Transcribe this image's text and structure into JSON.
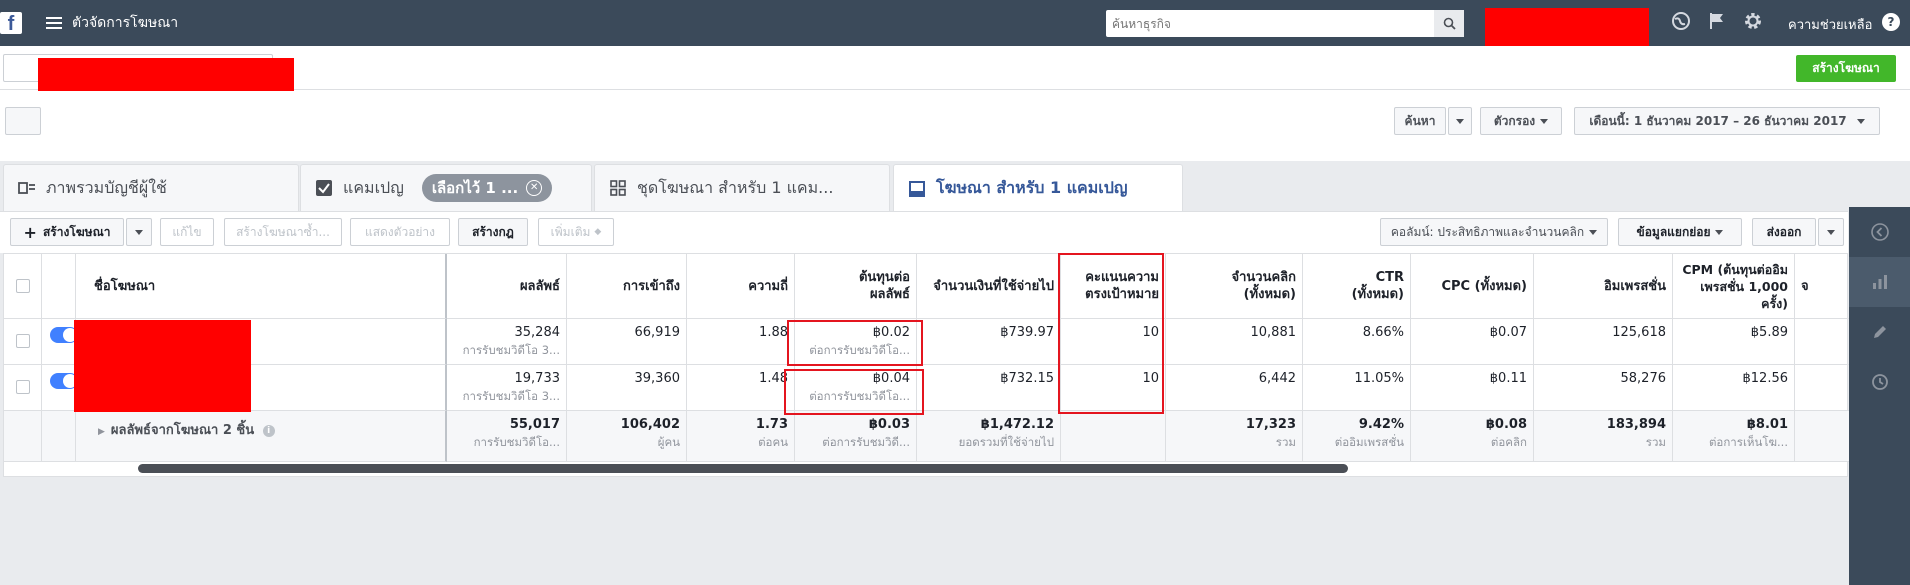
{
  "app": {
    "logo": "f",
    "title": "ตัวจัดการโฆษณา"
  },
  "search": {
    "placeholder": "ค้นหาธุรกิจ"
  },
  "header": {
    "help_label": "ความช่วยเหลือ",
    "help_q": "?"
  },
  "icons": {
    "globe": "globe-icon",
    "flag": "flag-icon",
    "gear": "gear-icon"
  },
  "create_ad_button": "สร้างโฆษณา",
  "controls": {
    "search_label": "ค้นหา",
    "filters_label": "ตัวกรอง",
    "date_range": "เดือนนี้: 1 ธันวาคม 2017 – 26 ธันวาคม 2017"
  },
  "tabs": [
    {
      "label": "ภาพรวมบัญชีผู้ใช้"
    },
    {
      "label": "แคมเปญ",
      "pill": "เลือกไว้ 1 ..."
    },
    {
      "label": "ชุดโฆษณา สำหรับ 1 แคม..."
    },
    {
      "label": "โฆษณา สำหรับ 1 แคมเปญ"
    }
  ],
  "toolbar": {
    "create": "สร้างโฆษณา",
    "edit": "แก้ไข",
    "duplicate": "สร้างโฆษณาซ้ำ...",
    "preview": "แสดงตัวอย่าง",
    "create_rule": "สร้างกฎ",
    "more": "เพิ่มเติม",
    "columns": "คอลัมน์: ประสิทธิภาพและจำนวนคลิก",
    "breakdown": "ข้อมูลแยกย่อย",
    "export": "ส่งออก"
  },
  "table": {
    "headers": {
      "name": "ชื่อโฆษณา",
      "results": "ผลลัพธ์",
      "reach": "การเข้าถึง",
      "frequency": "ความถี่",
      "cpr": "ต้นทุนต่อผลลัพธ์",
      "spent": "จำนวนเงินที่ใช้จ่ายไป",
      "relevance": "คะแนนความตรงเป้าหมาย",
      "clicks": "จำนวนคลิก (ทั้งหมด)",
      "ctr": "CTR (ทั้งหมด)",
      "cpc": "CPC (ทั้งหมด)",
      "impressions": "อิมเพรสชั่น",
      "cpm": "CPM (ต้นทุนต่ออิมเพรสชั่น 1,000 ครั้ง)",
      "extra": "จ"
    },
    "rows": [
      {
        "results": "35,284",
        "results_sub": "การรับชมวิดีโอ 3...",
        "reach": "66,919",
        "frequency": "1.88",
        "cpr": "฿0.02",
        "cpr_sub": "ต่อการรับชมวิดีโอ...",
        "spent": "฿739.97",
        "relevance": "10",
        "clicks": "10,881",
        "ctr": "8.66%",
        "cpc": "฿0.07",
        "impressions": "125,618",
        "cpm": "฿5.89"
      },
      {
        "results": "19,733",
        "results_sub": "การรับชมวิดีโอ 3...",
        "reach": "39,360",
        "frequency": "1.48",
        "cpr": "฿0.04",
        "cpr_sub": "ต่อการรับชมวิดีโอ...",
        "spent": "฿732.15",
        "relevance": "10",
        "clicks": "6,442",
        "ctr": "11.05%",
        "cpc": "฿0.11",
        "impressions": "58,276",
        "cpm": "฿12.56"
      }
    ],
    "totals": {
      "label": "ผลลัพธ์จากโฆษณา 2 ชิ้น",
      "results": "55,017",
      "results_sub": "การรับชมวิดีโอ...",
      "reach": "106,402",
      "reach_sub": "ผู้คน",
      "frequency": "1.73",
      "frequency_sub": "ต่อคน",
      "cpr": "฿0.03",
      "cpr_sub": "ต่อการรับชมวิดี...",
      "spent": "฿1,472.12",
      "spent_sub": "ยอดรวมที่ใช้จ่ายไป",
      "clicks": "17,323",
      "clicks_sub": "รวม",
      "ctr": "9.42%",
      "ctr_sub": "ต่ออิมเพรสชั่น",
      "cpc": "฿0.08",
      "cpc_sub": "ต่อคลิก",
      "impressions": "183,894",
      "impressions_sub": "รวม",
      "cpm": "฿8.01",
      "cpm_sub": "ต่อการเห็นโฆ..."
    }
  },
  "colors": {
    "topbar": "#3b4a5a",
    "green": "#42b72a",
    "toggle": "#4080ff",
    "highlight": "#e4151f",
    "redaction": "#ff0000"
  }
}
